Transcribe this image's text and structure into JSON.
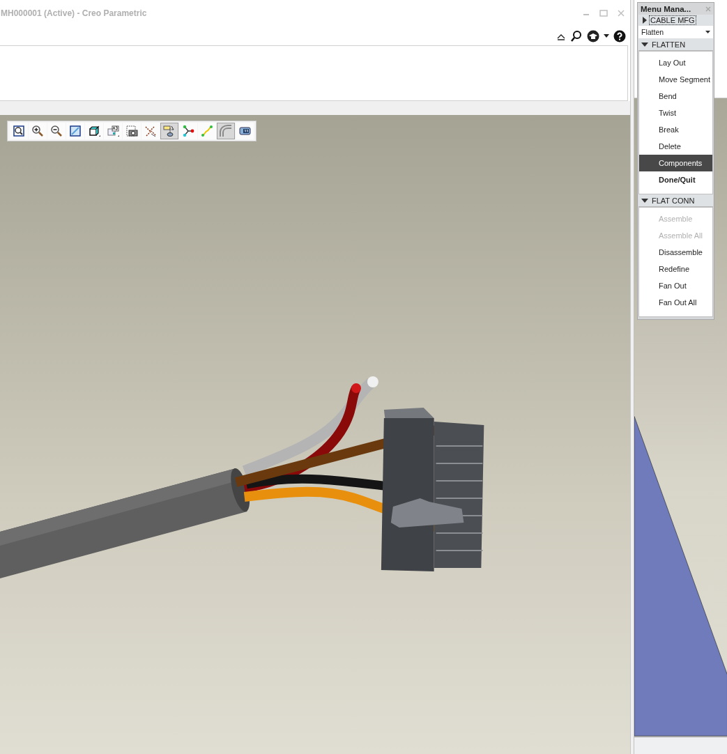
{
  "window": {
    "title": "MH000001 (Active) - Creo Parametric"
  },
  "view_toolbar": [
    {
      "kind": "refit",
      "selected": false
    },
    {
      "kind": "zoom_in",
      "selected": false
    },
    {
      "kind": "zoom_out",
      "selected": false
    },
    {
      "kind": "repaint",
      "selected": false
    },
    {
      "kind": "display_style",
      "selected": false
    },
    {
      "kind": "saved_views",
      "selected": false
    },
    {
      "kind": "snapshot",
      "selected": false
    },
    {
      "kind": "datum_display",
      "selected": false
    },
    {
      "kind": "annotation_display",
      "selected": true
    },
    {
      "kind": "network",
      "selected": false
    },
    {
      "kind": "path",
      "selected": false
    },
    {
      "kind": "thick_cable",
      "selected": true
    },
    {
      "kind": "spool",
      "selected": false
    }
  ],
  "menu_manager": {
    "title": "Menu Mana...",
    "menu_path": "CABLE MFG",
    "dropdown": {
      "value": "Flatten"
    },
    "sections": [
      {
        "title": "FLATTEN",
        "expanded": true,
        "items": [
          {
            "label": "Lay Out",
            "kind": "command",
            "selected": false,
            "disabled": false
          },
          {
            "label": "Move Segment",
            "kind": "command",
            "selected": false,
            "disabled": false
          },
          {
            "label": "Bend",
            "kind": "command",
            "selected": false,
            "disabled": false
          },
          {
            "label": "Twist",
            "kind": "command",
            "selected": false,
            "disabled": false
          },
          {
            "label": "Break",
            "kind": "command",
            "selected": false,
            "disabled": false
          },
          {
            "label": "Delete",
            "kind": "command",
            "selected": false,
            "disabled": false
          },
          {
            "label": "Components",
            "kind": "command",
            "selected": true,
            "disabled": false
          },
          {
            "label": "Done/Quit",
            "kind": "done",
            "selected": false,
            "disabled": false
          }
        ]
      },
      {
        "title": "FLAT CONN",
        "expanded": true,
        "items": [
          {
            "label": "Assemble",
            "kind": "command",
            "selected": false,
            "disabled": true
          },
          {
            "label": "Assemble All",
            "kind": "command",
            "selected": false,
            "disabled": true
          },
          {
            "label": "Disassemble",
            "kind": "command",
            "selected": false,
            "disabled": false
          },
          {
            "label": "Redefine",
            "kind": "command",
            "selected": false,
            "disabled": false
          },
          {
            "label": "Fan Out",
            "kind": "command",
            "selected": false,
            "disabled": false
          },
          {
            "label": "Fan Out All",
            "kind": "command",
            "selected": false,
            "disabled": false
          }
        ]
      }
    ]
  }
}
